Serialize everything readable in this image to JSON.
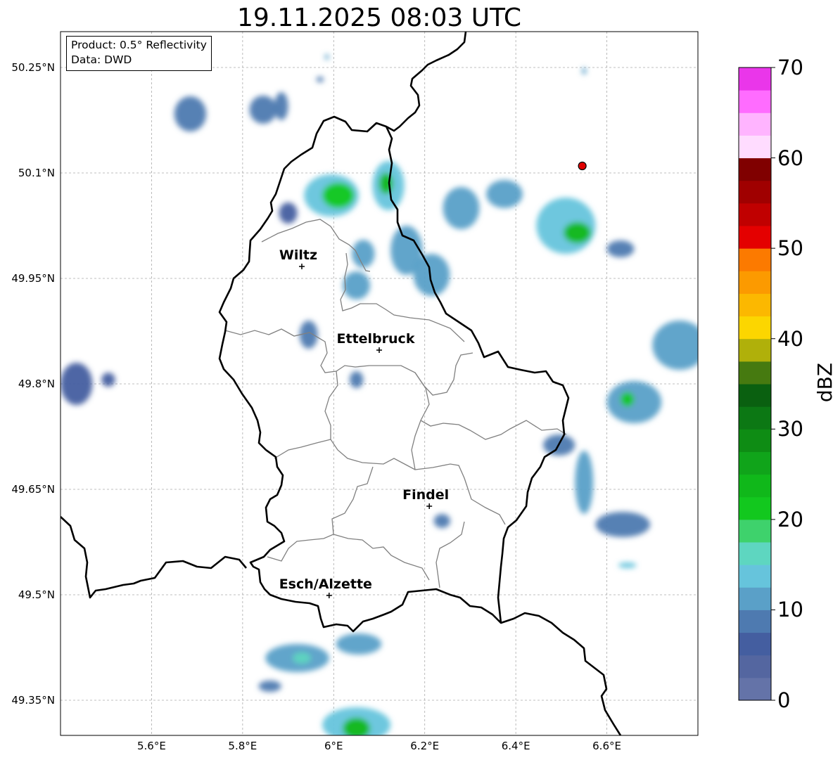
{
  "title": "19.11.2025 08:03 UTC",
  "info_box": {
    "product": "Product: 0.5° Reflectivity",
    "data": "Data: DWD"
  },
  "map_extent": {
    "lon_min": 5.4,
    "lon_max": 6.8,
    "lat_min": 49.3,
    "lat_max": 50.3
  },
  "longitude_ticks": [
    {
      "value": 5.6,
      "label": "5.6°E"
    },
    {
      "value": 5.8,
      "label": "5.8°E"
    },
    {
      "value": 6.0,
      "label": "6°E"
    },
    {
      "value": 6.2,
      "label": "6.2°E"
    },
    {
      "value": 6.4,
      "label": "6.4°E"
    },
    {
      "value": 6.6,
      "label": "6.6°E"
    }
  ],
  "latitude_ticks": [
    {
      "value": 50.25,
      "label": "50.25°N"
    },
    {
      "value": 50.1,
      "label": "50.1°N"
    },
    {
      "value": 49.95,
      "label": "49.95°N"
    },
    {
      "value": 49.8,
      "label": "49.8°N"
    },
    {
      "value": 49.65,
      "label": "49.65°N"
    },
    {
      "value": 49.5,
      "label": "49.5°N"
    },
    {
      "value": 49.35,
      "label": "49.35°N"
    }
  ],
  "cities": [
    {
      "name": "Wiltz",
      "lon": 5.93,
      "lat": 49.967
    },
    {
      "name": "Ettelbruck",
      "lon": 6.1,
      "lat": 49.848
    },
    {
      "name": "Findel",
      "lon": 6.21,
      "lat": 49.626
    },
    {
      "name": "Esch/Alzette",
      "lon": 5.99,
      "lat": 49.499
    }
  ],
  "radar_site": {
    "lon": 6.546,
    "lat": 50.11,
    "color": "#e00000"
  },
  "grid": true,
  "colorbar": {
    "label": "dBZ",
    "min": 0,
    "max": 70,
    "ticks": [
      0,
      10,
      20,
      30,
      40,
      50,
      60,
      70
    ],
    "colors": [
      "#6473a8",
      "#5466a0",
      "#445ea0",
      "#4e7ab0",
      "#5aa0c8",
      "#66c4dc",
      "#5ed6c0",
      "#3ed26c",
      "#12c81e",
      "#10b81a",
      "#10a41a",
      "#0e8c14",
      "#0c7814",
      "#0a6010",
      "#467a10",
      "#b0b00a",
      "#fcd600",
      "#fcb800",
      "#fc9a00",
      "#fc7a00",
      "#e40000",
      "#c00000",
      "#a00000",
      "#800000",
      "#ffdcff",
      "#ffb4ff",
      "#ff6cff",
      "#ea36ea"
    ]
  },
  "echoes": [
    {
      "lon": 5.685,
      "lat": 50.184,
      "dlon": 0.035,
      "dlat": 0.025,
      "dbz": 8
    },
    {
      "lon": 5.845,
      "lat": 50.19,
      "dlon": 0.03,
      "dlat": 0.02,
      "dbz": 8
    },
    {
      "lon": 5.885,
      "lat": 50.195,
      "dlon": 0.015,
      "dlat": 0.02,
      "dbz": 9
    },
    {
      "lon": 5.435,
      "lat": 49.8,
      "dlon": 0.035,
      "dlat": 0.03,
      "dbz": 6
    },
    {
      "lon": 5.505,
      "lat": 49.806,
      "dlon": 0.015,
      "dlat": 0.01,
      "dbz": 6
    },
    {
      "lon": 5.9,
      "lat": 50.043,
      "dlon": 0.02,
      "dlat": 0.015,
      "dbz": 6
    },
    {
      "lon": 5.995,
      "lat": 50.068,
      "dlon": 0.06,
      "dlat": 0.03,
      "dbz": 14
    },
    {
      "lon": 6.01,
      "lat": 50.068,
      "dlon": 0.035,
      "dlat": 0.018,
      "dbz": 21
    },
    {
      "lon": 6.12,
      "lat": 50.082,
      "dlon": 0.035,
      "dlat": 0.035,
      "dbz": 14
    },
    {
      "lon": 6.115,
      "lat": 50.085,
      "dlon": 0.015,
      "dlat": 0.015,
      "dbz": 23
    },
    {
      "lon": 6.16,
      "lat": 49.99,
      "dlon": 0.035,
      "dlat": 0.035,
      "dbz": 12
    },
    {
      "lon": 6.215,
      "lat": 49.955,
      "dlon": 0.04,
      "dlat": 0.03,
      "dbz": 12
    },
    {
      "lon": 6.28,
      "lat": 50.05,
      "dlon": 0.04,
      "dlat": 0.03,
      "dbz": 11
    },
    {
      "lon": 6.375,
      "lat": 50.07,
      "dlon": 0.04,
      "dlat": 0.02,
      "dbz": 11
    },
    {
      "lon": 6.51,
      "lat": 50.025,
      "dlon": 0.065,
      "dlat": 0.04,
      "dbz": 14
    },
    {
      "lon": 6.535,
      "lat": 50.015,
      "dlon": 0.03,
      "dlat": 0.015,
      "dbz": 23
    },
    {
      "lon": 6.63,
      "lat": 49.992,
      "dlon": 0.03,
      "dlat": 0.012,
      "dbz": 8
    },
    {
      "lon": 6.065,
      "lat": 49.985,
      "dlon": 0.025,
      "dlat": 0.02,
      "dbz": 12
    },
    {
      "lon": 6.05,
      "lat": 49.94,
      "dlon": 0.03,
      "dlat": 0.02,
      "dbz": 10
    },
    {
      "lon": 5.945,
      "lat": 49.87,
      "dlon": 0.02,
      "dlat": 0.02,
      "dbz": 8
    },
    {
      "lon": 6.05,
      "lat": 49.806,
      "dlon": 0.015,
      "dlat": 0.012,
      "dbz": 8
    },
    {
      "lon": 6.76,
      "lat": 49.855,
      "dlon": 0.06,
      "dlat": 0.035,
      "dbz": 10
    },
    {
      "lon": 6.66,
      "lat": 49.774,
      "dlon": 0.06,
      "dlat": 0.03,
      "dbz": 12
    },
    {
      "lon": 6.645,
      "lat": 49.778,
      "dlon": 0.015,
      "dlat": 0.01,
      "dbz": 22
    },
    {
      "lon": 6.495,
      "lat": 49.713,
      "dlon": 0.035,
      "dlat": 0.015,
      "dbz": 8
    },
    {
      "lon": 6.55,
      "lat": 49.66,
      "dlon": 0.02,
      "dlat": 0.045,
      "dbz": 10
    },
    {
      "lon": 6.635,
      "lat": 49.6,
      "dlon": 0.06,
      "dlat": 0.018,
      "dbz": 9
    },
    {
      "lon": 6.238,
      "lat": 49.605,
      "dlon": 0.018,
      "dlat": 0.01,
      "dbz": 8
    },
    {
      "lon": 6.645,
      "lat": 49.542,
      "dlon": 0.02,
      "dlat": 0.004,
      "dbz": 14
    },
    {
      "lon": 6.055,
      "lat": 49.43,
      "dlon": 0.05,
      "dlat": 0.015,
      "dbz": 12
    },
    {
      "lon": 5.92,
      "lat": 49.41,
      "dlon": 0.07,
      "dlat": 0.02,
      "dbz": 12
    },
    {
      "lon": 5.93,
      "lat": 49.41,
      "dlon": 0.02,
      "dlat": 0.008,
      "dbz": 16
    },
    {
      "lon": 5.86,
      "lat": 49.37,
      "dlon": 0.025,
      "dlat": 0.008,
      "dbz": 8
    },
    {
      "lon": 6.05,
      "lat": 49.315,
      "dlon": 0.075,
      "dlat": 0.025,
      "dbz": 14
    },
    {
      "lon": 6.05,
      "lat": 49.31,
      "dlon": 0.03,
      "dlat": 0.015,
      "dbz": 24
    },
    {
      "lon": 6.55,
      "lat": 50.245,
      "dlon": 0.005,
      "dlat": 0.005,
      "dbz": 12
    },
    {
      "lon": 5.985,
      "lat": 50.265,
      "dlon": 0.004,
      "dlat": 0.004,
      "dbz": 10
    },
    {
      "lon": 5.97,
      "lat": 50.233,
      "dlon": 0.008,
      "dlat": 0.004,
      "dbz": 8
    }
  ]
}
